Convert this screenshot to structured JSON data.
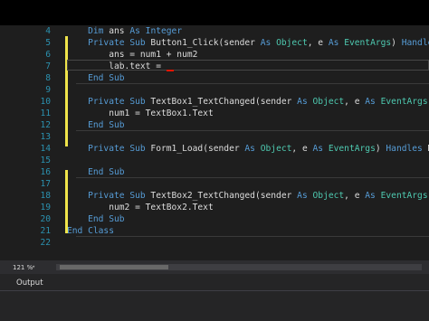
{
  "editor": {
    "lines": [
      {
        "num": "4",
        "tokens": [
          {
            "t": "    "
          },
          {
            "t": "Dim",
            "c": "kw"
          },
          {
            "t": " ans "
          },
          {
            "t": "As",
            "c": "kw"
          },
          {
            "t": " "
          },
          {
            "t": "Integer",
            "c": "kw"
          }
        ]
      },
      {
        "num": "5",
        "tokens": [
          {
            "t": "    "
          },
          {
            "t": "Private Sub",
            "c": "kw"
          },
          {
            "t": " Button1_Click(sender "
          },
          {
            "t": "As",
            "c": "kw"
          },
          {
            "t": " "
          },
          {
            "t": "Object",
            "c": "tp"
          },
          {
            "t": ", e "
          },
          {
            "t": "As",
            "c": "kw"
          },
          {
            "t": " "
          },
          {
            "t": "EventArgs",
            "c": "tp"
          },
          {
            "t": ") "
          },
          {
            "t": "Handles",
            "c": "kw"
          },
          {
            "t": " Button1"
          }
        ]
      },
      {
        "num": "6",
        "tokens": [
          {
            "t": "        ans = num1 + num2"
          }
        ]
      },
      {
        "num": "7",
        "tokens": [
          {
            "t": "        lab.text = "
          }
        ]
      },
      {
        "num": "8",
        "tokens": [
          {
            "t": "    "
          },
          {
            "t": "End Sub",
            "c": "kw"
          }
        ]
      },
      {
        "num": "9",
        "tokens": []
      },
      {
        "num": "10",
        "tokens": [
          {
            "t": "    "
          },
          {
            "t": "Private Sub",
            "c": "kw"
          },
          {
            "t": " TextBox1_TextChanged(sender "
          },
          {
            "t": "As",
            "c": "kw"
          },
          {
            "t": " "
          },
          {
            "t": "Object",
            "c": "tp"
          },
          {
            "t": ", e "
          },
          {
            "t": "As",
            "c": "kw"
          },
          {
            "t": " "
          },
          {
            "t": "EventArgs",
            "c": "tp"
          },
          {
            "t": ") "
          },
          {
            "t": "Ha",
            "c": "kw"
          }
        ]
      },
      {
        "num": "11",
        "tokens": [
          {
            "t": "        num1 = TextBox1.Text"
          }
        ]
      },
      {
        "num": "12",
        "tokens": [
          {
            "t": "    "
          },
          {
            "t": "End Sub",
            "c": "kw"
          }
        ]
      },
      {
        "num": "13",
        "tokens": []
      },
      {
        "num": "14",
        "tokens": [
          {
            "t": "    "
          },
          {
            "t": "Private Sub",
            "c": "kw"
          },
          {
            "t": " Form1_Load(sender "
          },
          {
            "t": "As",
            "c": "kw"
          },
          {
            "t": " "
          },
          {
            "t": "Object",
            "c": "tp"
          },
          {
            "t": ", e "
          },
          {
            "t": "As",
            "c": "kw"
          },
          {
            "t": " "
          },
          {
            "t": "EventArgs",
            "c": "tp"
          },
          {
            "t": ") "
          },
          {
            "t": "Handles",
            "c": "kw"
          },
          {
            "t": " MyBa"
          }
        ]
      },
      {
        "num": "15",
        "tokens": []
      },
      {
        "num": "16",
        "tokens": [
          {
            "t": "    "
          },
          {
            "t": "End Sub",
            "c": "kw"
          }
        ]
      },
      {
        "num": "17",
        "tokens": []
      },
      {
        "num": "18",
        "tokens": [
          {
            "t": "    "
          },
          {
            "t": "Private Sub",
            "c": "kw"
          },
          {
            "t": " TextBox2_TextChanged(sender "
          },
          {
            "t": "As",
            "c": "kw"
          },
          {
            "t": " "
          },
          {
            "t": "Object",
            "c": "tp"
          },
          {
            "t": ", e "
          },
          {
            "t": "As",
            "c": "kw"
          },
          {
            "t": " "
          },
          {
            "t": "EventArgs",
            "c": "tp"
          },
          {
            "t": ") "
          },
          {
            "t": "Ha",
            "c": "kw"
          }
        ]
      },
      {
        "num": "19",
        "tokens": [
          {
            "t": "        num2 = TextBox2.Text"
          }
        ]
      },
      {
        "num": "20",
        "tokens": [
          {
            "t": "    "
          },
          {
            "t": "End Sub",
            "c": "kw"
          }
        ]
      },
      {
        "num": "21",
        "tokens": [
          {
            "t": "End Class",
            "c": "kw"
          }
        ]
      },
      {
        "num": "22",
        "tokens": []
      }
    ]
  },
  "status": {
    "zoom": "121 %",
    "zoom_icon": "chevron-down-icon"
  },
  "output_panel": {
    "title": "Output"
  },
  "colors": {
    "background": "#1e1e1e",
    "keyword": "#569cd6",
    "type": "#4ec9b0",
    "line_number": "#2b91af",
    "change_marker": "#efe44a",
    "error_squiggle": "#e51400"
  }
}
